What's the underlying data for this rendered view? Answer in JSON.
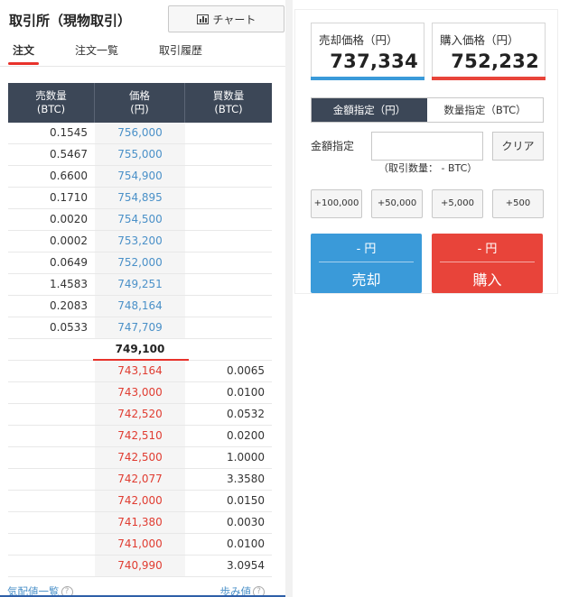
{
  "header": {
    "title": "取引所（現物取引）",
    "chart_button": "チャート"
  },
  "tabs": [
    {
      "label": "注文"
    },
    {
      "label": "注文一覧"
    },
    {
      "label": "取引履歴"
    }
  ],
  "orderbook": {
    "headers": {
      "sell_qty": [
        "売数量",
        "(BTC)"
      ],
      "price": [
        "価格",
        "(円)"
      ],
      "buy_qty": [
        "買数量",
        "(BTC)"
      ]
    },
    "asks": [
      {
        "qty": "0.1545",
        "price": "756,000"
      },
      {
        "qty": "0.5467",
        "price": "755,000"
      },
      {
        "qty": "0.6600",
        "price": "754,900"
      },
      {
        "qty": "0.1710",
        "price": "754,895"
      },
      {
        "qty": "0.0020",
        "price": "754,500"
      },
      {
        "qty": "0.0002",
        "price": "753,200"
      },
      {
        "qty": "0.0649",
        "price": "752,000"
      },
      {
        "qty": "1.4583",
        "price": "749,251"
      },
      {
        "qty": "0.2083",
        "price": "748,164"
      },
      {
        "qty": "0.0533",
        "price": "747,709"
      }
    ],
    "mid_price": "749,100",
    "bids": [
      {
        "price": "743,164",
        "qty": "0.0065"
      },
      {
        "price": "743,000",
        "qty": "0.0100"
      },
      {
        "price": "742,520",
        "qty": "0.0532"
      },
      {
        "price": "742,510",
        "qty": "0.0200"
      },
      {
        "price": "742,500",
        "qty": "1.0000"
      },
      {
        "price": "742,077",
        "qty": "3.3580"
      },
      {
        "price": "742,000",
        "qty": "0.0150"
      },
      {
        "price": "741,380",
        "qty": "0.0030"
      },
      {
        "price": "741,000",
        "qty": "0.0100"
      },
      {
        "price": "740,990",
        "qty": "3.0954"
      }
    ],
    "footer_left": "気配値一覧",
    "footer_right": "歩み値",
    "help_glyph": "?"
  },
  "trade": {
    "sell_price_label": "売却価格（円）",
    "sell_price": "737,334",
    "buy_price_label": "購入価格（円）",
    "buy_price": "752,232",
    "mode_amount": "金額指定（円）",
    "mode_quantity": "数量指定（BTC）",
    "amount_label": "金額指定",
    "amount_value": "",
    "clear_button": "クリア",
    "qty_note": "（取引数量： - BTC）",
    "increments": [
      "+100,000",
      "+50,000",
      "+5,000",
      "+500"
    ],
    "sell_button_top": "- 円",
    "sell_button_label": "売却",
    "buy_button_top": "- 円",
    "buy_button_label": "購入",
    "colors": {
      "sell": "#3a9ad9",
      "buy": "#e8443a",
      "header_dark": "#3c4757",
      "accent_red": "#e8322b"
    }
  }
}
